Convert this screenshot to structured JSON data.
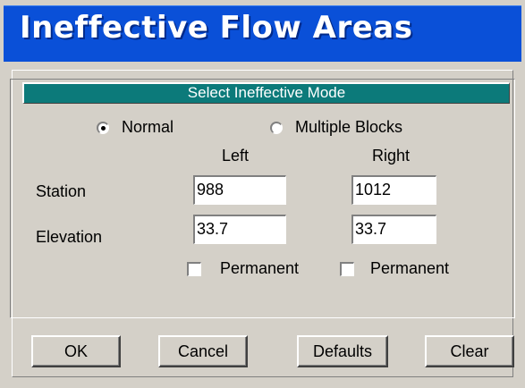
{
  "window": {
    "title": "Ineffective Flow Areas"
  },
  "mode": {
    "header": "Select Ineffective Mode",
    "options": [
      {
        "label": "Normal",
        "checked": true
      },
      {
        "label": "Multiple Blocks",
        "checked": false
      }
    ]
  },
  "columns": {
    "left": "Left",
    "right": "Right"
  },
  "rows": {
    "station": {
      "label": "Station",
      "left": "988",
      "right": "1012"
    },
    "elevation": {
      "label": "Elevation",
      "left": "33.7",
      "right": "33.7"
    }
  },
  "permanent": {
    "left": {
      "label": "Permanent",
      "checked": false
    },
    "right": {
      "label": "Permanent",
      "checked": false
    }
  },
  "buttons": {
    "ok": "OK",
    "cancel": "Cancel",
    "defaults": "Defaults",
    "clear": "Clear"
  },
  "colors": {
    "titlebar": "#0a50d8",
    "header": "#0c7a7a",
    "face": "#d4d0c8"
  }
}
